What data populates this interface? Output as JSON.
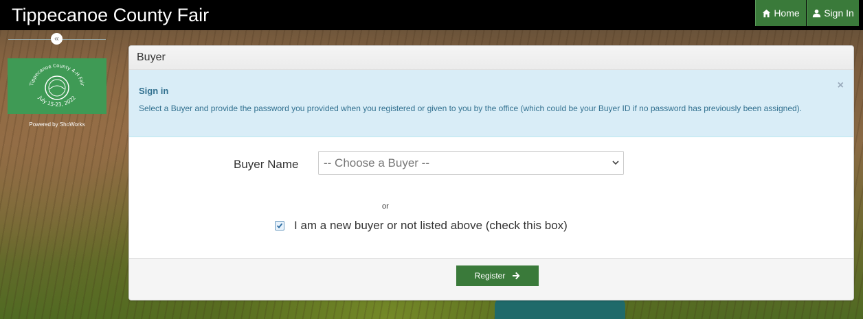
{
  "header": {
    "title": "Tippecanoe County Fair",
    "home_label": "Home",
    "signin_label": "Sign In"
  },
  "sidebar": {
    "collapse_icon": "double-chevron-left-icon",
    "logo_text_top": "Tippecanoe County 4-H Fair",
    "logo_text_bottom": "July 15-23, 2022",
    "powered_by": "Powered by ShoWorks"
  },
  "panel": {
    "heading": "Buyer",
    "alert": {
      "title": "Sign in",
      "text": "Select a Buyer and provide the password you provided when you registered or given to you by the office (which could be your Buyer ID if no password has previously been assigned).",
      "close_label": "×"
    },
    "buyer_name_label": "Buyer Name",
    "buyer_select_value": "-- Choose a Buyer --",
    "or_text": "or",
    "new_buyer_label": "I am a new buyer or not listed above (check this box)",
    "new_buyer_checked": true,
    "register_label": "Register"
  },
  "colors": {
    "nav_green": "#3a7a3a",
    "alert_bg": "#d9edf7",
    "alert_text": "#31708f",
    "logo_green": "#3f9a55"
  }
}
